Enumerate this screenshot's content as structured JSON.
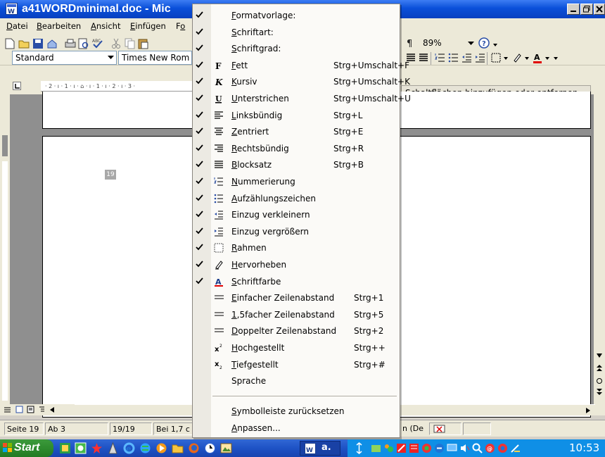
{
  "titlebar": {
    "title": "a41WORDminimal.doc - Mic"
  },
  "menubar": {
    "items": [
      "Datei",
      "Bearbeiten",
      "Ansicht",
      "Einfügen",
      "Fo"
    ],
    "accel": [
      "D",
      "B",
      "A",
      "E",
      "o"
    ]
  },
  "toolbar": {
    "zoom": "89%",
    "style": "Standard",
    "font": "Times New Rom",
    "add_remove_label": "Schaltflächen hinzufügen oder entfernen"
  },
  "ruler": {
    "text": "· 2 · ı · 1 · ı · ⌂ · ı · 1 · ı · 2 · ı · 3 ·"
  },
  "document": {
    "field_text": "19"
  },
  "statusbar": {
    "page": "Seite 19",
    "section": "Ab 3",
    "pages": "19/19",
    "position": "Bei 1,7 c",
    "lang": "n (De"
  },
  "taskbar": {
    "start_label": "Start",
    "task_label": "a.",
    "clock": "10:53"
  },
  "dropdown": {
    "checked_items": [
      {
        "label": "Formatvorlage:",
        "acc": "F",
        "shortcut": "",
        "icon": "none"
      },
      {
        "label": "Schriftart:",
        "acc": "S",
        "shortcut": "",
        "icon": "none"
      },
      {
        "label": "Schriftgrad:",
        "acc": "S",
        "shortcut": "",
        "icon": "none"
      },
      {
        "label": "Fett",
        "acc": "F",
        "shortcut": "Strg+Umschalt+F",
        "icon": "bold-icon"
      },
      {
        "label": "Kursiv",
        "acc": "K",
        "shortcut": "Strg+Umschalt+K",
        "icon": "italic-icon"
      },
      {
        "label": "Unterstrichen",
        "acc": "U",
        "shortcut": "Strg+Umschalt+U",
        "icon": "underline-icon"
      },
      {
        "label": "Linksbündig",
        "acc": "L",
        "shortcut": "Strg+L",
        "icon": "align-left-icon"
      },
      {
        "label": "Zentriert",
        "acc": "Z",
        "shortcut": "Strg+E",
        "icon": "align-center-icon"
      },
      {
        "label": "Rechtsbündig",
        "acc": "R",
        "shortcut": "Strg+R",
        "icon": "align-right-icon"
      },
      {
        "label": "Blocksatz",
        "acc": "B",
        "shortcut": "Strg+B",
        "icon": "justify-icon"
      },
      {
        "label": "Nummerierung",
        "acc": "N",
        "shortcut": "",
        "icon": "numbering-icon"
      },
      {
        "label": "Aufzählungszeichen",
        "acc": "A",
        "shortcut": "",
        "icon": "bullets-icon"
      },
      {
        "label": "Einzug verkleinern",
        "acc": "",
        "shortcut": "",
        "icon": "indent-decrease-icon"
      },
      {
        "label": "Einzug vergrößern",
        "acc": "",
        "shortcut": "",
        "icon": "indent-increase-icon"
      },
      {
        "label": "Rahmen",
        "acc": "R",
        "shortcut": "",
        "icon": "border-icon"
      },
      {
        "label": "Hervorheben",
        "acc": "H",
        "shortcut": "",
        "icon": "highlight-icon"
      },
      {
        "label": "Schriftfarbe",
        "acc": "S",
        "shortcut": "",
        "icon": "font-color-icon"
      }
    ],
    "unchecked_items": [
      {
        "label": "Einfacher Zeilenabstand",
        "acc": "E",
        "shortcut": "Strg+1",
        "icon": "line-spacing-icon"
      },
      {
        "label": "1,5facher Zeilenabstand",
        "acc": "1",
        "shortcut": "Strg+5",
        "icon": "line-spacing-icon"
      },
      {
        "label": "Doppelter Zeilenabstand",
        "acc": "D",
        "shortcut": "Strg+2",
        "icon": "line-spacing-icon"
      },
      {
        "label": "Hochgestellt",
        "acc": "H",
        "shortcut": "Strg++",
        "icon": "superscript-icon"
      },
      {
        "label": "Tiefgestellt",
        "acc": "T",
        "shortcut": "Strg+#",
        "icon": "subscript-icon"
      },
      {
        "label": "Sprache",
        "acc": "",
        "shortcut": "",
        "icon": "none"
      }
    ],
    "footer_items": [
      {
        "label": "Symbolleiste zurücksetzen",
        "acc": "S"
      },
      {
        "label": "Anpassen...",
        "acc": "A"
      }
    ]
  },
  "colors": {
    "titlebar": "#0a4fd9",
    "accent_red": "#e00000",
    "taskbar": "#1e52c5",
    "start_green": "#2e8b2e"
  }
}
